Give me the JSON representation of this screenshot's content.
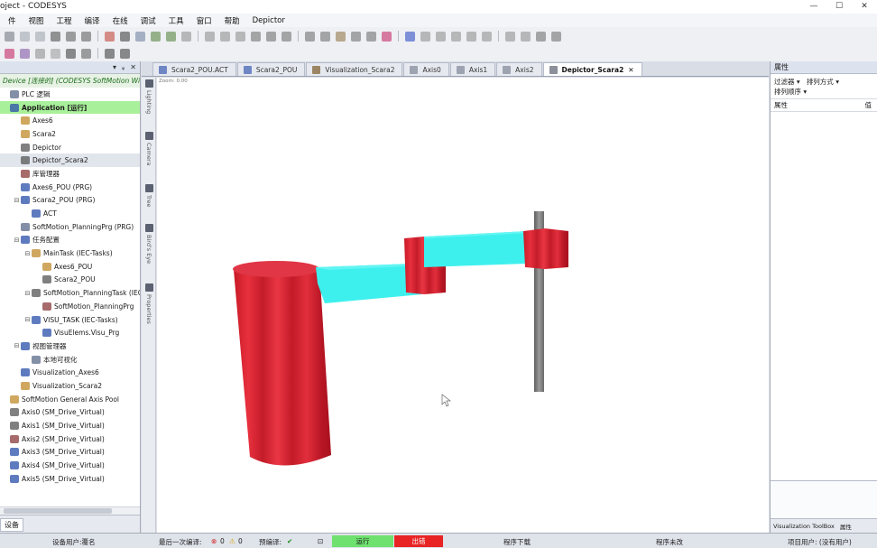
{
  "window": {
    "title": "oject - CODESYS",
    "minimize": "—",
    "maximize": "☐",
    "close": "✕"
  },
  "menu": [
    "件",
    "视图",
    "工程",
    "编译",
    "在线",
    "调试",
    "工具",
    "窗口",
    "帮助",
    "Depictor"
  ],
  "device_panel": {
    "pin": "ᵩ",
    "autohide": "ᵩ",
    "close": "✕",
    "device_line": "Device [连接的] (CODESYS SoftMotion Win V",
    "tab_label": "设备",
    "tree": [
      {
        "label": "PLC 逻辑",
        "indent": 0,
        "exp": ""
      },
      {
        "label": "Application [运行]",
        "indent": 0,
        "exp": "",
        "active": true
      },
      {
        "label": "Axes6",
        "indent": 1,
        "exp": ""
      },
      {
        "label": "Scara2",
        "indent": 1,
        "exp": ""
      },
      {
        "label": "Depictor",
        "indent": 1,
        "exp": ""
      },
      {
        "label": "Depictor_Scara2",
        "indent": 1,
        "exp": "",
        "selected": true
      },
      {
        "label": "库管理器",
        "indent": 1,
        "exp": ""
      },
      {
        "label": "Axes6_POU (PRG)",
        "indent": 1,
        "exp": ""
      },
      {
        "label": "Scara2_POU (PRG)",
        "indent": 1,
        "exp": "⊟"
      },
      {
        "label": "ACT",
        "indent": 2,
        "exp": ""
      },
      {
        "label": "SoftMotion_PlanningPrg (PRG)",
        "indent": 1,
        "exp": ""
      },
      {
        "label": "任务配置",
        "indent": 1,
        "exp": "⊟"
      },
      {
        "label": "MainTask (IEC-Tasks)",
        "indent": 2,
        "exp": "⊟"
      },
      {
        "label": "Axes6_POU",
        "indent": 3,
        "exp": ""
      },
      {
        "label": "Scara2_POU",
        "indent": 3,
        "exp": ""
      },
      {
        "label": "SoftMotion_PlanningTask (IEC-T",
        "indent": 2,
        "exp": "⊟"
      },
      {
        "label": "SoftMotion_PlanningPrg",
        "indent": 3,
        "exp": ""
      },
      {
        "label": "VISU_TASK (IEC-Tasks)",
        "indent": 2,
        "exp": "⊟"
      },
      {
        "label": "VisuElems.Visu_Prg",
        "indent": 3,
        "exp": ""
      },
      {
        "label": "视图管理器",
        "indent": 1,
        "exp": "⊟"
      },
      {
        "label": "本地可视化",
        "indent": 2,
        "exp": ""
      },
      {
        "label": "Visualization_Axes6",
        "indent": 1,
        "exp": ""
      },
      {
        "label": "Visualization_Scara2",
        "indent": 1,
        "exp": ""
      },
      {
        "label": "SoftMotion General Axis Pool",
        "indent": 0,
        "exp": ""
      },
      {
        "label": "Axis0 (SM_Drive_Virtual)",
        "indent": 0,
        "exp": ""
      },
      {
        "label": "Axis1 (SM_Drive_Virtual)",
        "indent": 0,
        "exp": ""
      },
      {
        "label": "Axis2 (SM_Drive_Virtual)",
        "indent": 0,
        "exp": ""
      },
      {
        "label": "Axis3 (SM_Drive_Virtual)",
        "indent": 0,
        "exp": ""
      },
      {
        "label": "Axis4 (SM_Drive_Virtual)",
        "indent": 0,
        "exp": ""
      },
      {
        "label": "Axis5 (SM_Drive_Virtual)",
        "indent": 0,
        "exp": ""
      }
    ]
  },
  "editor_tabs": [
    {
      "label": "Scara2_POU.ACT",
      "color": "#3b5bb0"
    },
    {
      "label": "Scara2_POU",
      "color": "#3b5bb0"
    },
    {
      "label": "Visualization_Scara2",
      "color": "#7a5a2a"
    },
    {
      "label": "Axis0",
      "color": "#7d8597"
    },
    {
      "label": "Axis1",
      "color": "#7d8597"
    },
    {
      "label": "Axis2",
      "color": "#7d8597"
    },
    {
      "label": "Depictor_Scara2",
      "color": "#5b6170",
      "active": true,
      "close": "✕"
    }
  ],
  "side_tabs": [
    "Lighting",
    "Camera",
    "Tree",
    "Bird's Eye",
    "Properties"
  ],
  "viewport": {
    "zoom_text": "Zoom: 0.00"
  },
  "properties_panel": {
    "title": "属性",
    "filter": "过滤器 ▾",
    "sort_by": "排列方式 ▾",
    "sort_order": "排列顺序 ▾",
    "col_prop": "属性",
    "col_value": "值",
    "tabs": [
      "Visualization ToolBox",
      "属性"
    ]
  },
  "status": {
    "device_user": "设备用户:覆名",
    "last_compile": "最后一次编译:",
    "errors": "0",
    "warnings": "0",
    "precompile": "预编译:",
    "run_state": "运行",
    "stop_state": "出错",
    "download": "程序下载",
    "unchanged": "程序未改",
    "project_user": "项目用户: (没有用户)"
  },
  "colors": {
    "run": "#6fe16f",
    "stop": "#e82424",
    "robot_red": "#d2202e",
    "robot_cyan": "#3ff0ee",
    "shaft": "#808080"
  }
}
